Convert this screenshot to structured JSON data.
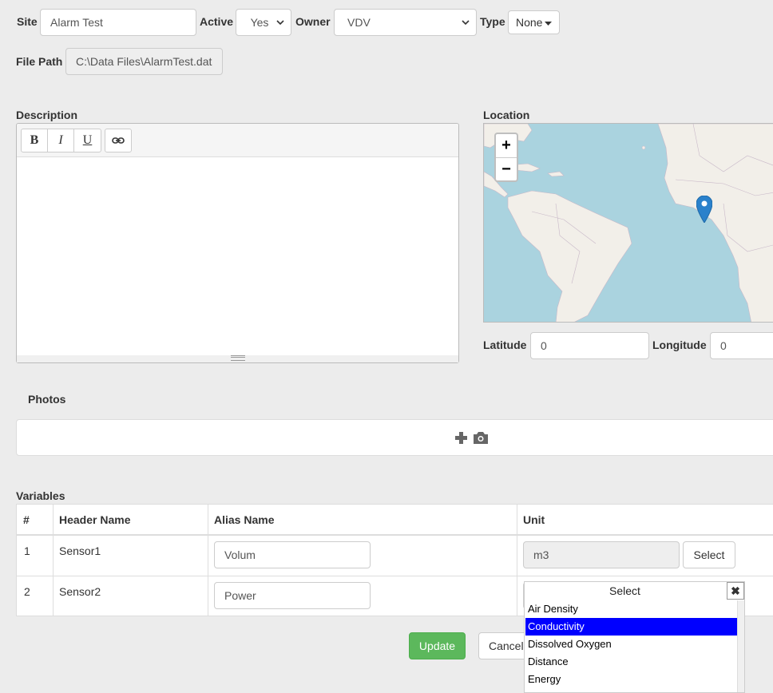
{
  "form": {
    "site_label": "Site",
    "site_value": "Alarm Test",
    "active_label": "Active",
    "active_value": "Yes",
    "owner_label": "Owner",
    "owner_value": "VDV",
    "type_label": "Type",
    "type_value": "None",
    "filepath_label": "File Path",
    "filepath_value": "C:\\Data Files\\AlarmTest.dat"
  },
  "description": {
    "label": "Description",
    "toolbar": {
      "bold": "B",
      "italic": "I",
      "underline": "U"
    }
  },
  "location": {
    "label": "Location",
    "zoom_in": "+",
    "zoom_out": "−",
    "latitude_label": "Latitude",
    "latitude_value": "0",
    "longitude_label": "Longitude",
    "longitude_value": "0"
  },
  "photos": {
    "label": "Photos",
    "add_icon": "plus-camera-icon"
  },
  "variables": {
    "label": "Variables",
    "headers": [
      "#",
      "Header Name",
      "Alias Name",
      "Unit"
    ],
    "rows": [
      {
        "num": "1",
        "header": "Sensor1",
        "alias": "Volum",
        "unit": "m3",
        "select_label": "Select"
      },
      {
        "num": "2",
        "header": "Sensor2",
        "alias": "Power",
        "unit": ""
      }
    ]
  },
  "unit_popup": {
    "title": "Select",
    "close": "✖",
    "items": [
      "Air Density",
      "Conductivity",
      "Dissolved Oxygen",
      "Distance",
      "Energy"
    ],
    "selected": "Conductivity"
  },
  "actions": {
    "update": "Update",
    "cancel": "Cancel"
  },
  "colors": {
    "update_bg": "#5cb85c",
    "map_water": "#aad3df",
    "map_land": "#f2efe9",
    "marker": "#2a81cb",
    "selection": "#0000ff"
  }
}
